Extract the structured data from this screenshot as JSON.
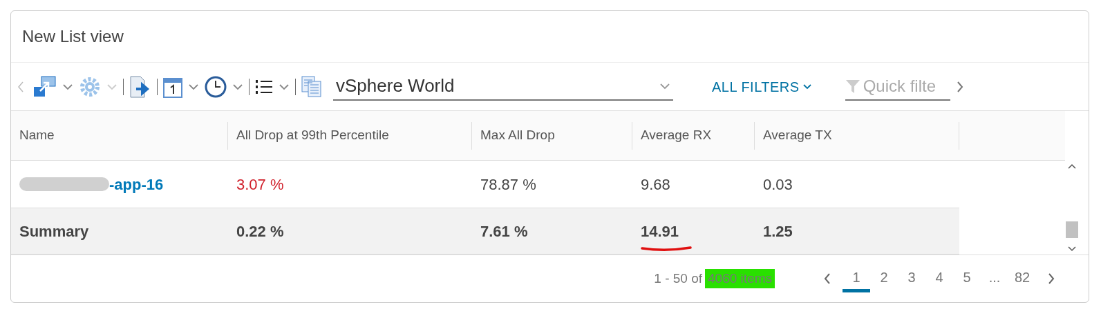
{
  "panel": {
    "title": "New List view"
  },
  "toolbar": {
    "scope": "vSphere World",
    "all_filters": "ALL FILTERS",
    "quick_filter": {
      "placeholder": "Quick filte"
    }
  },
  "table": {
    "columns": [
      "Name",
      "All Drop at 99th Percentile",
      "Max All Drop",
      "Average RX",
      "Average TX"
    ],
    "rows": [
      {
        "kind": "item",
        "cells": [
          {
            "kind": "redacted",
            "text": "-app-16"
          },
          {
            "kind": "alert",
            "text": "3.07 %"
          },
          {
            "kind": "plain",
            "text": "78.87 %"
          },
          {
            "kind": "plain",
            "text": "9.68"
          },
          {
            "kind": "plain",
            "text": "0.03"
          }
        ]
      },
      {
        "kind": "summary",
        "cells": [
          {
            "kind": "plain",
            "text": "Summary"
          },
          {
            "kind": "plain",
            "text": "0.22 %"
          },
          {
            "kind": "plain",
            "text": "7.61 %"
          },
          {
            "kind": "underlined",
            "text": "14.91"
          },
          {
            "kind": "plain",
            "text": "1.25"
          }
        ]
      }
    ]
  },
  "footer": {
    "range": "1 - 50 of",
    "total": "4060 items",
    "pages": [
      {
        "label": "1",
        "selected": true
      },
      {
        "label": "2",
        "selected": false
      },
      {
        "label": "3",
        "selected": false
      },
      {
        "label": "4",
        "selected": false
      },
      {
        "label": "5",
        "selected": false
      },
      {
        "label": "...",
        "selected": false
      },
      {
        "label": "82",
        "selected": false
      }
    ]
  }
}
